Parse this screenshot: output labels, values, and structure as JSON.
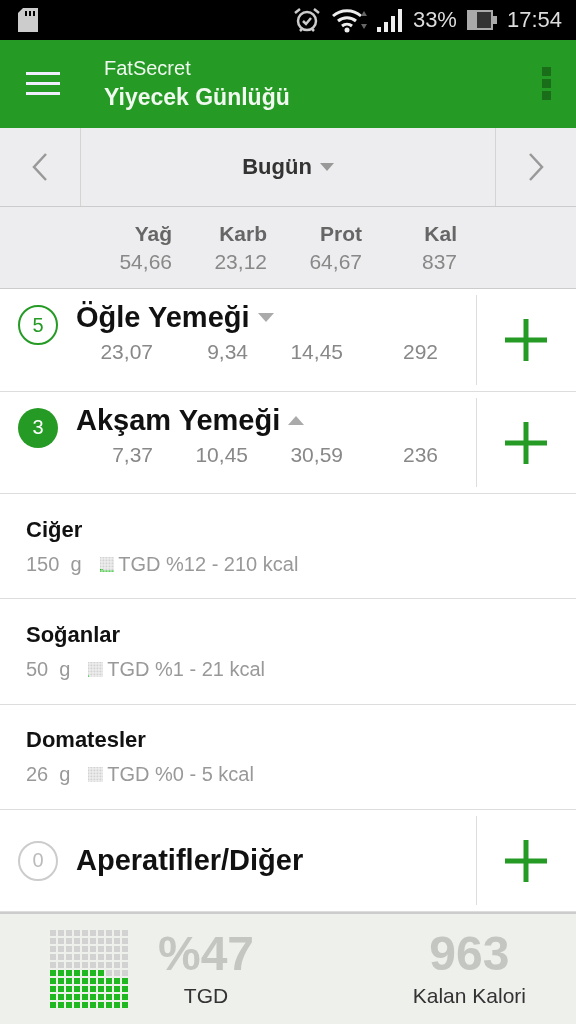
{
  "status_bar": {
    "battery": "33%",
    "time": "17:54"
  },
  "app_bar": {
    "app_name": "FatSecret",
    "title": "Yiyecek Günlüğü"
  },
  "date_nav": {
    "label": "Bugün"
  },
  "totals": {
    "columns": [
      {
        "label": "Yağ",
        "value": "54,66"
      },
      {
        "label": "Karb",
        "value": "23,12"
      },
      {
        "label": "Prot",
        "value": "64,67"
      },
      {
        "label": "Kal",
        "value": "837"
      }
    ]
  },
  "meals": [
    {
      "count": "5",
      "name": "Öğle Yemeği",
      "expanded": false,
      "empty": false,
      "values": [
        "23,07",
        "9,34",
        "14,45",
        "292"
      ]
    },
    {
      "count": "3",
      "name": "Akşam Yemeği",
      "expanded": true,
      "empty": false,
      "values": [
        "7,37",
        "10,45",
        "30,59",
        "236"
      ],
      "foods": [
        {
          "name": "Ciğer",
          "amount": "150  g",
          "detail": "TGD %12 - 210 kcal"
        },
        {
          "name": "Soğanlar",
          "amount": "50  g",
          "detail": "TGD %1 - 21 kcal"
        },
        {
          "name": "Domatesler",
          "amount": "26  g",
          "detail": "TGD %0 - 5 kcal"
        }
      ]
    },
    {
      "count": "0",
      "name": "Aperatifler/Diğer",
      "expanded": false,
      "empty": true
    }
  ],
  "footer": {
    "percent": "%47",
    "percent_label": "TGD",
    "remaining": "963",
    "remaining_label": "Kalan Kalori"
  }
}
